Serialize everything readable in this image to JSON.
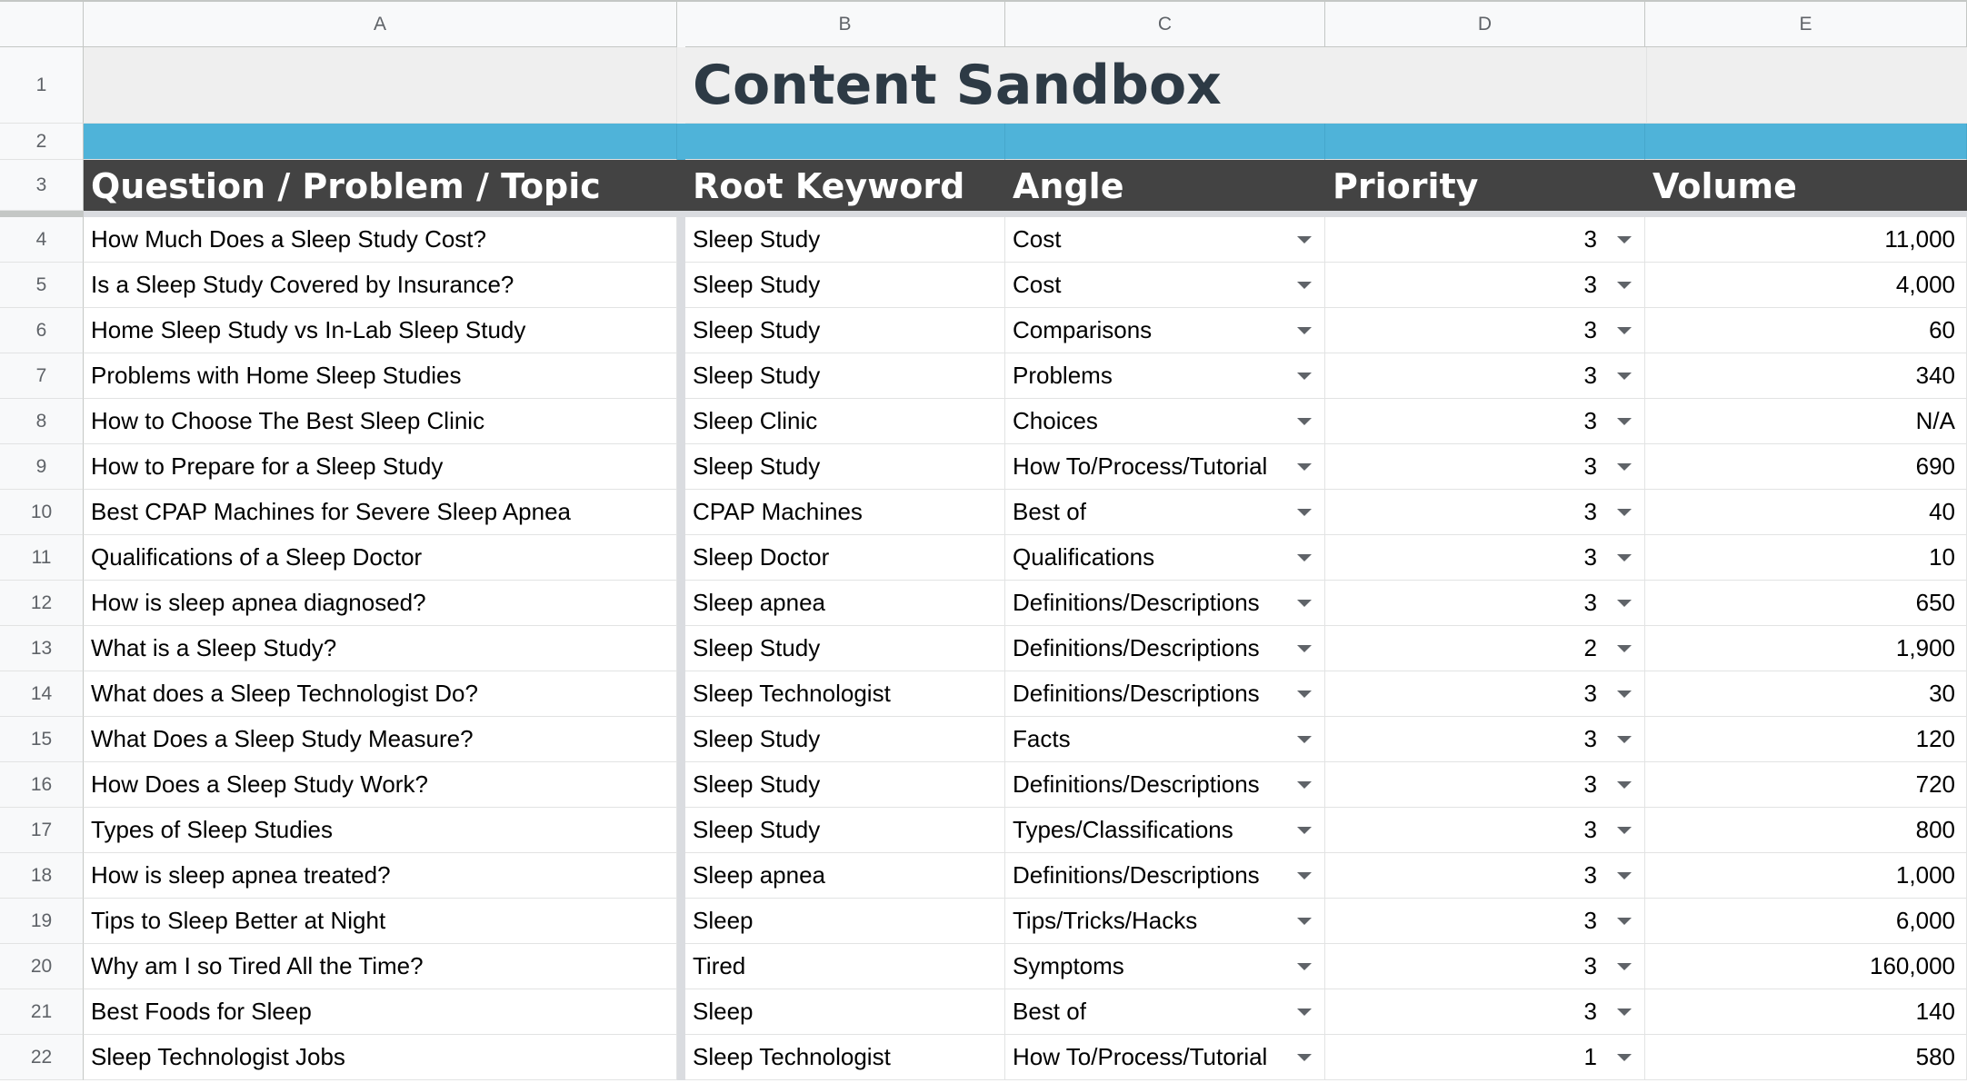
{
  "columns": [
    "A",
    "B",
    "C",
    "D",
    "E"
  ],
  "title_row": {
    "row_number": "1",
    "title": "Content Sandbox"
  },
  "band_row": {
    "row_number": "2"
  },
  "header_row": {
    "row_number": "3",
    "headers": [
      "Question / Problem / Topic",
      "Root Keyword",
      "Angle",
      "Priority",
      "Volume"
    ]
  },
  "rows": [
    {
      "n": "4",
      "topic": "How Much Does a Sleep Study Cost?",
      "keyword": "Sleep Study",
      "angle": "Cost",
      "priority": "3",
      "volume": "11,000"
    },
    {
      "n": "5",
      "topic": "Is a Sleep Study Covered by Insurance?",
      "keyword": "Sleep Study",
      "angle": "Cost",
      "priority": "3",
      "volume": "4,000"
    },
    {
      "n": "6",
      "topic": "Home Sleep Study vs In-Lab Sleep Study",
      "keyword": "Sleep Study",
      "angle": "Comparisons",
      "priority": "3",
      "volume": "60"
    },
    {
      "n": "7",
      "topic": "Problems with Home Sleep Studies",
      "keyword": "Sleep Study",
      "angle": "Problems",
      "priority": "3",
      "volume": "340"
    },
    {
      "n": "8",
      "topic": "How to Choose The Best Sleep Clinic",
      "keyword": "Sleep Clinic",
      "angle": "Choices",
      "priority": "3",
      "volume": "N/A"
    },
    {
      "n": "9",
      "topic": "How to Prepare for a Sleep Study",
      "keyword": "Sleep Study",
      "angle": "How To/Process/Tutorial",
      "priority": "3",
      "volume": "690"
    },
    {
      "n": "10",
      "topic": "Best CPAP Machines for Severe Sleep Apnea",
      "keyword": "CPAP Machines",
      "angle": "Best of",
      "priority": "3",
      "volume": "40"
    },
    {
      "n": "11",
      "topic": "Qualifications of a Sleep Doctor",
      "keyword": "Sleep Doctor",
      "angle": "Qualifications",
      "priority": "3",
      "volume": "10"
    },
    {
      "n": "12",
      "topic": "How is sleep apnea diagnosed?",
      "keyword": "Sleep apnea",
      "angle": "Definitions/Descriptions",
      "priority": "3",
      "volume": "650"
    },
    {
      "n": "13",
      "topic": "What is a Sleep Study?",
      "keyword": "Sleep Study",
      "angle": "Definitions/Descriptions",
      "priority": "2",
      "volume": "1,900"
    },
    {
      "n": "14",
      "topic": "What does a Sleep Technologist Do?",
      "keyword": "Sleep Technologist",
      "angle": "Definitions/Descriptions",
      "priority": "3",
      "volume": "30"
    },
    {
      "n": "15",
      "topic": "What Does a Sleep Study Measure?",
      "keyword": "Sleep Study",
      "angle": "Facts",
      "priority": "3",
      "volume": "120"
    },
    {
      "n": "16",
      "topic": "How Does a Sleep Study Work?",
      "keyword": "Sleep Study",
      "angle": "Definitions/Descriptions",
      "priority": "3",
      "volume": "720"
    },
    {
      "n": "17",
      "topic": "Types of Sleep Studies",
      "keyword": "Sleep Study",
      "angle": "Types/Classifications",
      "priority": "3",
      "volume": "800"
    },
    {
      "n": "18",
      "topic": "How is sleep apnea treated?",
      "keyword": "Sleep apnea",
      "angle": "Definitions/Descriptions",
      "priority": "3",
      "volume": "1,000"
    },
    {
      "n": "19",
      "topic": "Tips to Sleep Better at Night",
      "keyword": "Sleep",
      "angle": "Tips/Tricks/Hacks",
      "priority": "3",
      "volume": "6,000"
    },
    {
      "n": "20",
      "topic": "Why am I so Tired All the Time?",
      "keyword": "Tired",
      "angle": "Symptoms",
      "priority": "3",
      "volume": "160,000"
    },
    {
      "n": "21",
      "topic": "Best Foods for Sleep",
      "keyword": "Sleep",
      "angle": "Best of",
      "priority": "3",
      "volume": "140"
    },
    {
      "n": "22",
      "topic": "Sleep Technologist Jobs",
      "keyword": "Sleep Technologist",
      "angle": "How To/Process/Tutorial",
      "priority": "1",
      "volume": "580"
    }
  ],
  "icons": {
    "dropdown": "chevron-down-icon"
  },
  "colors": {
    "band": "#4fb3d9",
    "header_bg": "#434343",
    "title_text": "#2d3a45",
    "title_bg": "#efefef"
  }
}
